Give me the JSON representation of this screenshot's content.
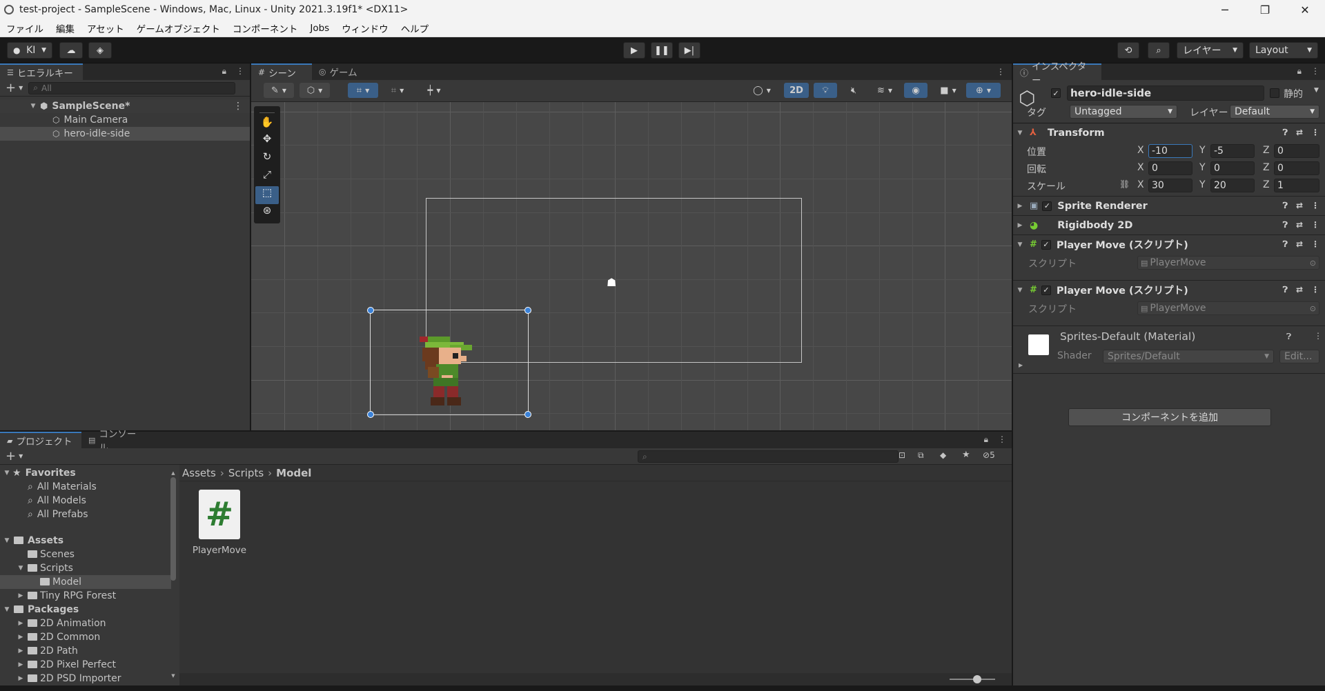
{
  "window": {
    "title": "test-project - SampleScene - Windows, Mac, Linux - Unity 2021.3.19f1* <DX11>",
    "controls": {
      "minimize": "─",
      "maximize": "❐",
      "close": "✕"
    }
  },
  "menu": [
    "ファイル",
    "編集",
    "アセット",
    "ゲームオブジェクト",
    "コンポーネント",
    "Jobs",
    "ウィンドウ",
    "ヘルプ"
  ],
  "toolbar": {
    "account": "KI",
    "layers_label": "レイヤー",
    "layout_label": "Layout"
  },
  "hierarchy": {
    "tab": "ヒエラルキー",
    "search_placeholder": "All",
    "scene": "SampleScene*",
    "items": [
      "Main Camera",
      "hero-idle-side"
    ]
  },
  "scene_view": {
    "tabs": [
      "シーン",
      "ゲーム"
    ],
    "mode_2d": "2D"
  },
  "inspector": {
    "tab": "インスペクター",
    "object_name": "hero-idle-side",
    "static_label": "静的",
    "tag_label": "タグ",
    "tag_value": "Untagged",
    "layer_label": "レイヤー",
    "layer_value": "Default",
    "transform": {
      "title": "Transform",
      "position_label": "位置",
      "rotation_label": "回転",
      "scale_label": "スケール",
      "position": {
        "x": "-10",
        "y": "-5",
        "z": "0"
      },
      "rotation": {
        "x": "0",
        "y": "0",
        "z": "0"
      },
      "scale": {
        "x": "30",
        "y": "20",
        "z": "1"
      }
    },
    "components": [
      "Sprite Renderer",
      "Rigidbody 2D",
      "Player Move (スクリプト)",
      "Player Move (スクリプト)"
    ],
    "script_label": "スクリプト",
    "script_value": "PlayerMove",
    "material": {
      "title": "Sprites-Default (Material)",
      "shader_label": "Shader",
      "shader_value": "Sprites/Default",
      "edit_label": "Edit..."
    },
    "add_component": "コンポーネントを追加"
  },
  "project": {
    "tabs": [
      "プロジェクト",
      "コンソール"
    ],
    "hidden_count": "5",
    "favorites": {
      "label": "Favorites",
      "items": [
        "All Materials",
        "All Models",
        "All Prefabs"
      ]
    },
    "assets": {
      "label": "Assets",
      "items": [
        "Scenes",
        "Scripts",
        "Model",
        "Tiny RPG Forest"
      ]
    },
    "packages": {
      "label": "Packages",
      "items": [
        "2D Animation",
        "2D Common",
        "2D Path",
        "2D Pixel Perfect",
        "2D PSD Importer"
      ]
    },
    "breadcrumb": [
      "Assets",
      "Scripts",
      "Model"
    ],
    "files": [
      {
        "name": "PlayerMove",
        "glyph": "#"
      }
    ]
  },
  "colors": {
    "accent": "#3a79bb",
    "panel": "#383838",
    "scene_bg": "#474747",
    "script_green": "#2e7d32"
  }
}
